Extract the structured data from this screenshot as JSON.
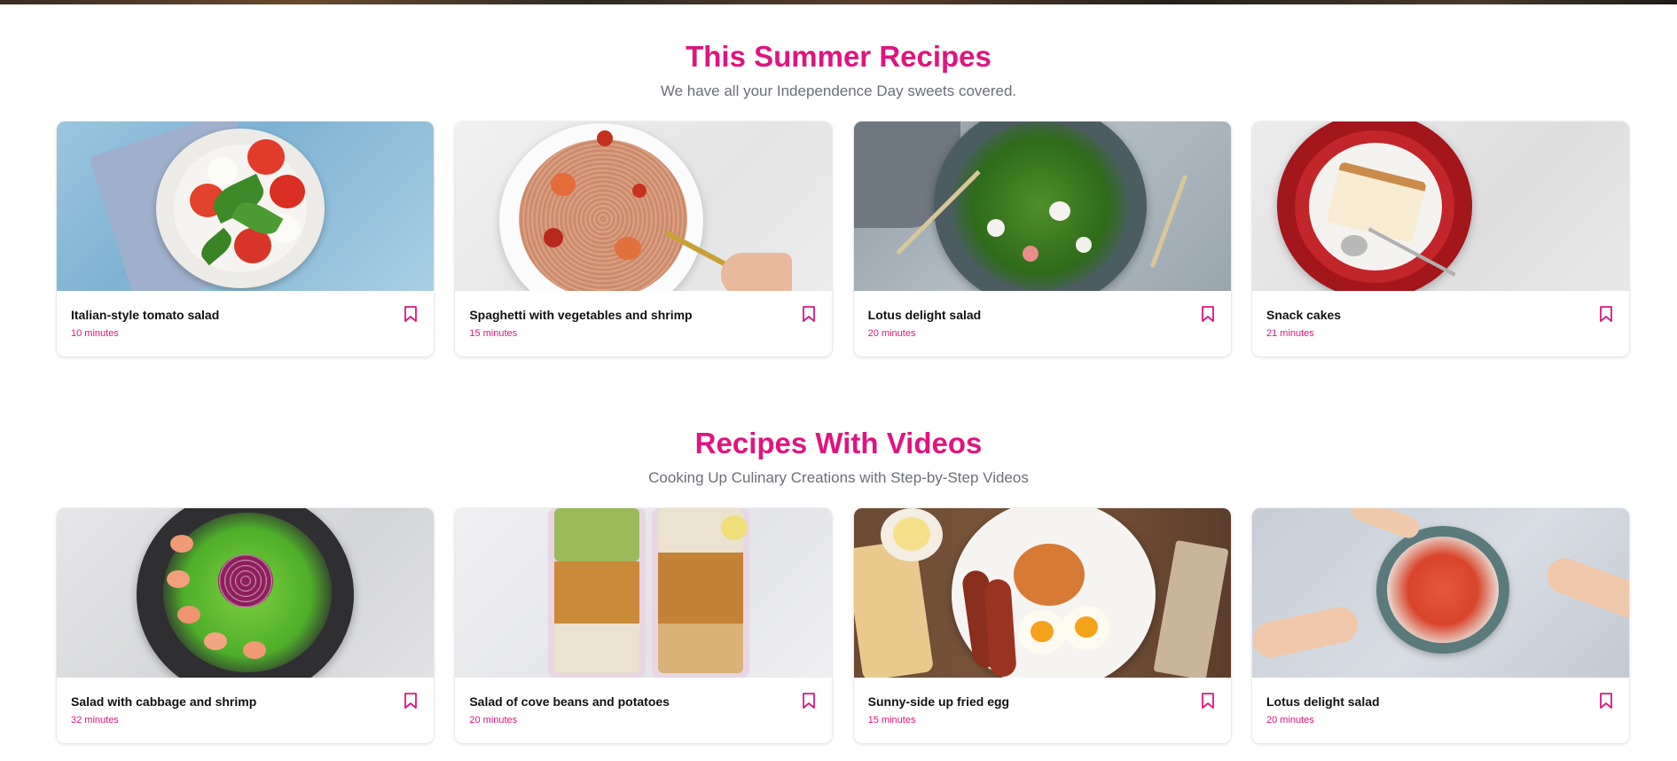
{
  "sections": [
    {
      "title": "This Summer Recipes",
      "subtitle": "We have all your Independence Day sweets covered.",
      "cards": [
        {
          "title": "Italian-style tomato salad",
          "time": "10 minutes",
          "image": "tomato-salad-image"
        },
        {
          "title": "Spaghetti with vegetables and shrimp",
          "time": "15 minutes",
          "image": "spaghetti-image"
        },
        {
          "title": "Lotus delight salad",
          "time": "20 minutes",
          "image": "green-salad-image"
        },
        {
          "title": "Snack cakes",
          "time": "21 minutes",
          "image": "snack-cake-image"
        }
      ]
    },
    {
      "title": "Recipes With Videos",
      "subtitle": "Cooking Up Culinary Creations with Step-by-Step Videos",
      "cards": [
        {
          "title": "Salad with cabbage and shrimp",
          "time": "32 minutes",
          "image": "shrimp-salad-image"
        },
        {
          "title": "Salad of cove beans and potatoes",
          "time": "20 minutes",
          "image": "beans-bowls-image"
        },
        {
          "title": "Sunny-side up fried egg",
          "time": "15 minutes",
          "image": "breakfast-image"
        },
        {
          "title": "Lotus delight salad",
          "time": "20 minutes",
          "image": "shrimp-platter-image"
        }
      ]
    }
  ],
  "icons": {
    "bookmark": "bookmark-icon"
  },
  "colors": {
    "accent": "#e0147f",
    "subtitle": "#6b6f7a"
  }
}
